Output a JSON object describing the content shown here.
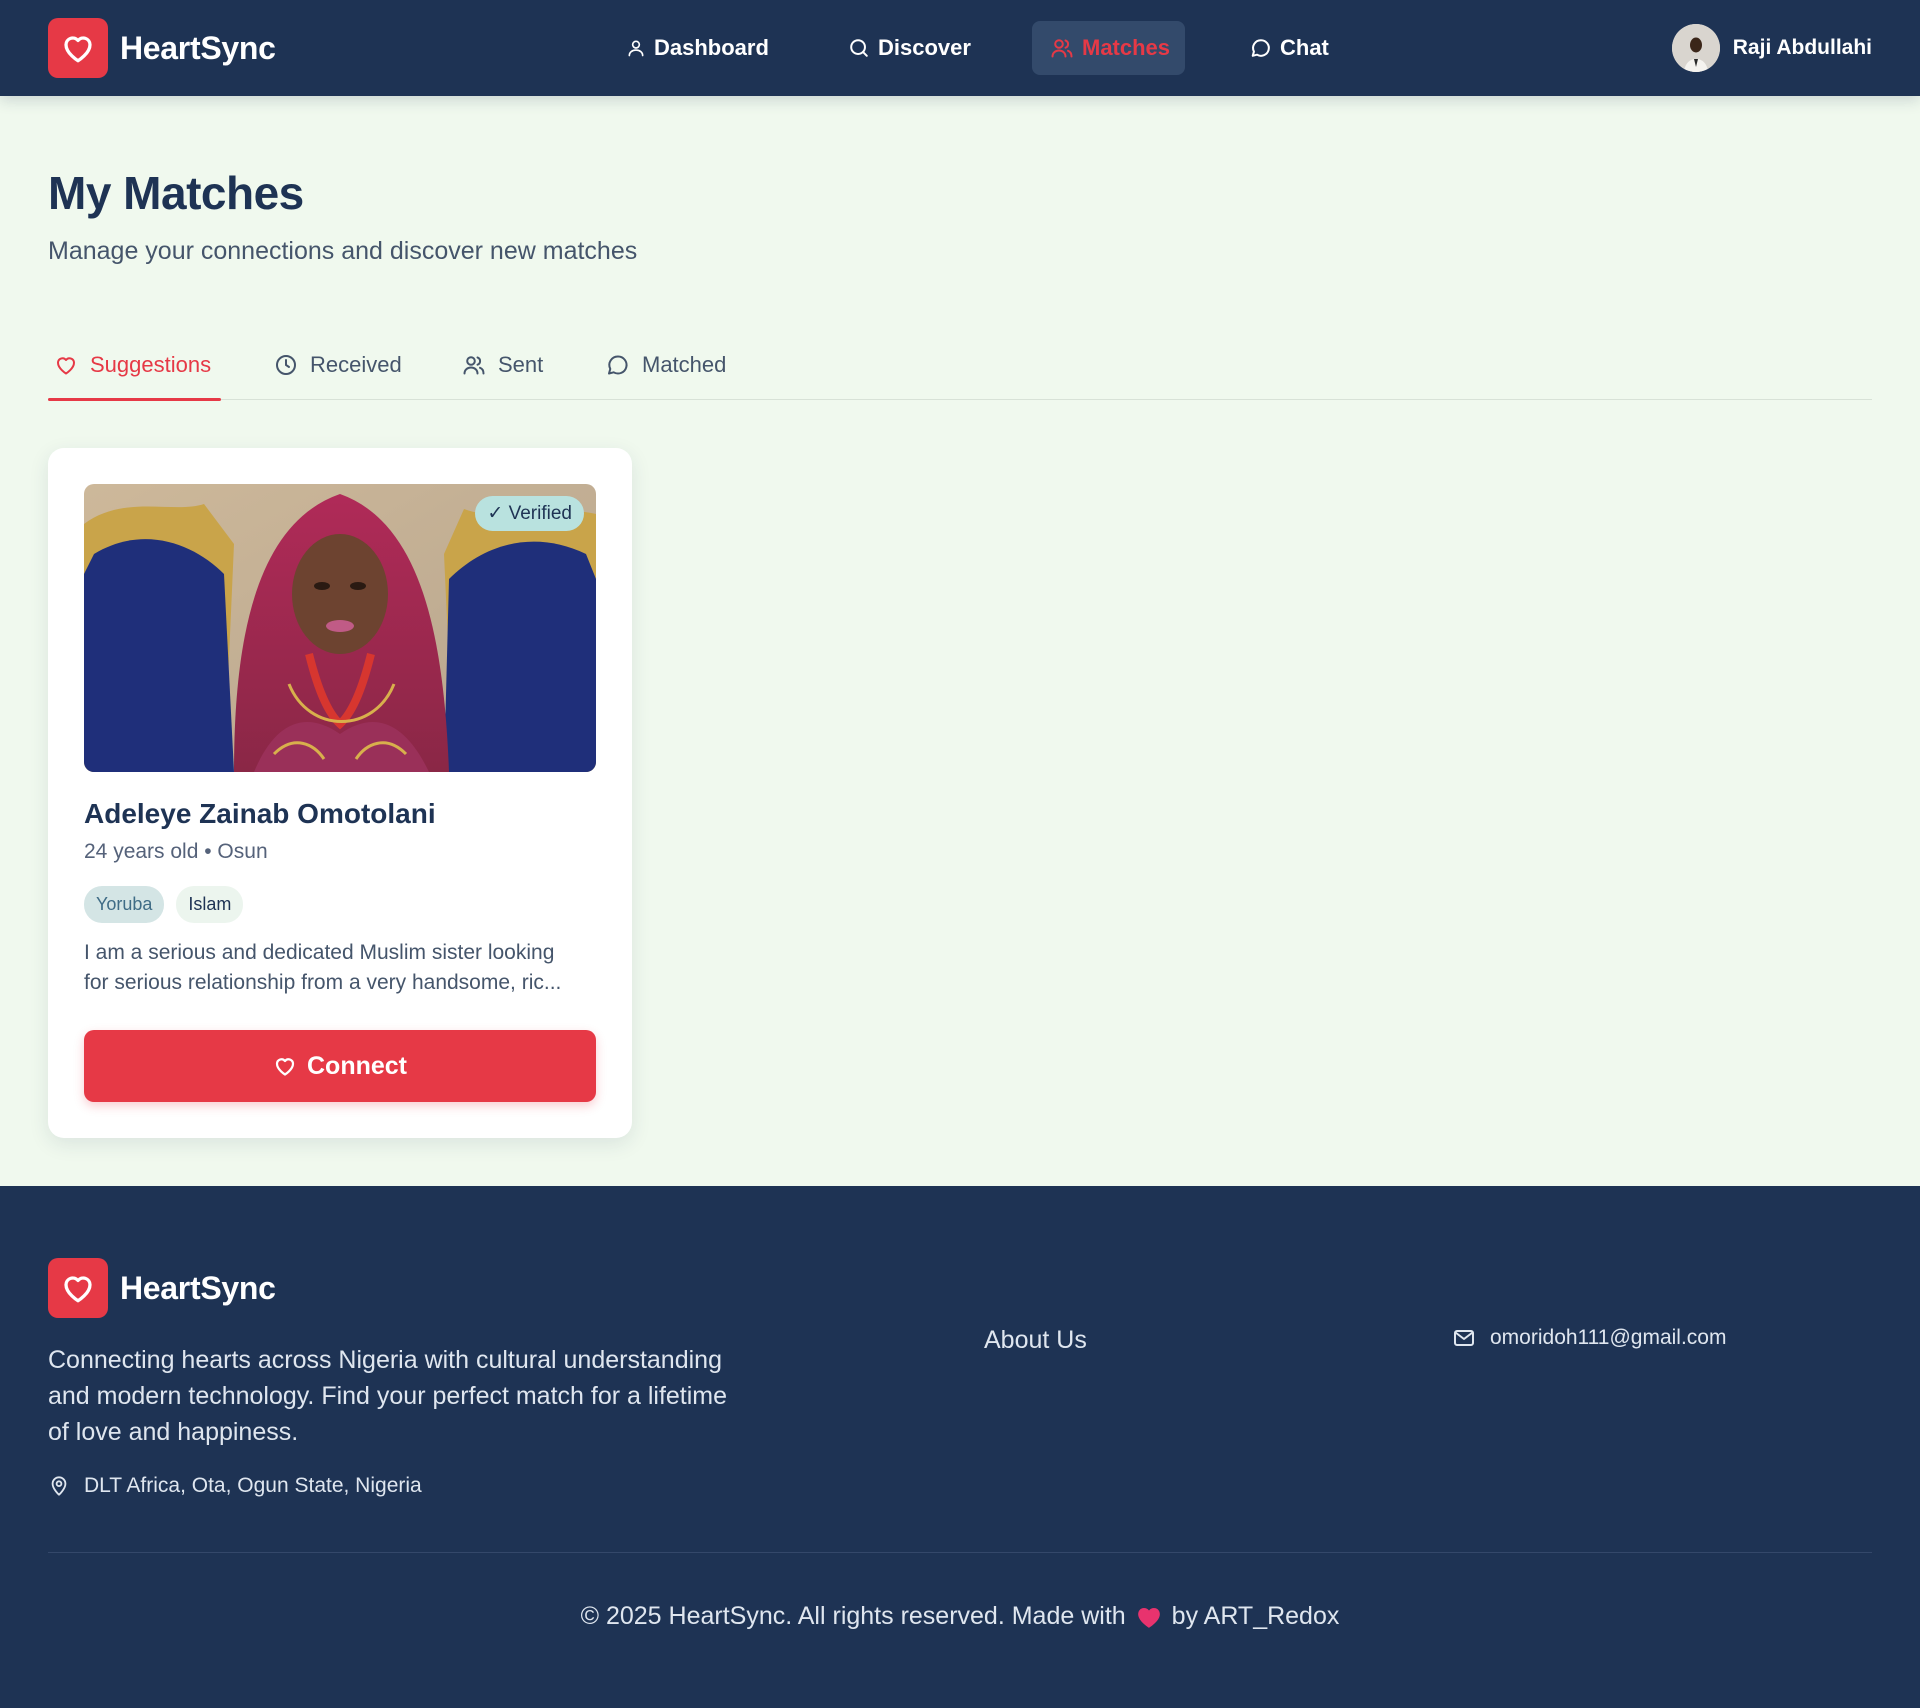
{
  "header": {
    "brand": "HeartSync",
    "nav": [
      {
        "label": "Dashboard",
        "icon": "user-icon"
      },
      {
        "label": "Discover",
        "icon": "search-icon"
      },
      {
        "label": "Matches",
        "icon": "users-icon",
        "active": true
      },
      {
        "label": "Chat",
        "icon": "chat-icon"
      }
    ],
    "user": {
      "name": "Raji Abdullahi"
    }
  },
  "main": {
    "title": "My Matches",
    "subtitle": "Manage your connections and discover new matches",
    "tabs": [
      {
        "label": "Suggestions",
        "icon": "heart-icon",
        "active": true
      },
      {
        "label": "Received",
        "icon": "clock-icon"
      },
      {
        "label": "Sent",
        "icon": "users-icon"
      },
      {
        "label": "Matched",
        "icon": "chat-icon"
      }
    ],
    "card": {
      "badge": "✓ Verified",
      "name": "Adeleye Zainab Omotolani",
      "meta": "24 years old • Osun",
      "tags": [
        "Yoruba",
        "Islam"
      ],
      "bio_line1": "I am a serious and dedicated Muslim sister looking",
      "bio_line2": "for serious relationship from a very handsome, ric...",
      "connect_label": "Connect"
    }
  },
  "footer": {
    "brand": "HeartSync",
    "about": "Connecting hearts across Nigeria with cultural understanding and modern technology. Find your perfect match for a lifetime of love and happiness.",
    "address": "DLT Africa, Ota, Ogun State, Nigeria",
    "link_about": "About Us",
    "email": "omoridoh111@gmail.com",
    "copyright_prefix": "© 2025 HeartSync. All rights reserved. Made with",
    "copyright_suffix": "by ART_Redox"
  },
  "colors": {
    "navy": "#1e3354",
    "accent": "#e63946",
    "background": "#f0f9ee"
  }
}
